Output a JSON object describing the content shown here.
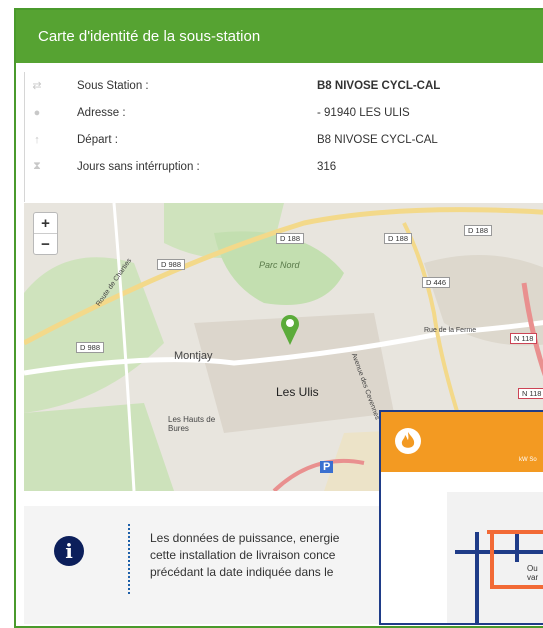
{
  "card": {
    "title": "Carte d'identité de la sous-station",
    "rows": [
      {
        "icon": "shuffle-icon",
        "label": "Sous Station :",
        "value": "B8 NIVOSE CYCL-CAL"
      },
      {
        "icon": "map-pin-icon",
        "label": "Adresse :",
        "value": "- 91940 LES ULIS"
      },
      {
        "icon": "arrow-up-icon",
        "label": "Départ :",
        "value": "B8 NIVOSE CYCL-CAL"
      },
      {
        "icon": "hourglass-icon",
        "label": "Jours sans intérruption :",
        "value": "316"
      }
    ]
  },
  "map": {
    "zoom_in": "+",
    "zoom_out": "−",
    "labels": {
      "parc_nord": "Parc Nord",
      "montjay": "Montjay",
      "les_ulis": "Les Ulis",
      "les_hauts": "Les Hauts de Bures",
      "route_charties": "Route de Charties",
      "rue_ferme": "Rue de la Ferme",
      "avenue": "Avenue des Cevennes",
      "parking": "P"
    },
    "roads": [
      "D 188",
      "D 988",
      "D 188",
      "D 188",
      "D 446",
      "N 118",
      "D 988",
      "N 118"
    ]
  },
  "notice": {
    "line1": "Les données de puissance, energie",
    "line2": "cette installation de livraison conce",
    "line3": "précédant la date indiquée dans le"
  },
  "overlay": {
    "bar_text": "kW So",
    "panel_text1": "Ou",
    "panel_text2": "var"
  },
  "colors": {
    "header_green": "#56a332",
    "info_navy": "#0c1f5b",
    "overlay_orange": "#f39a22"
  }
}
